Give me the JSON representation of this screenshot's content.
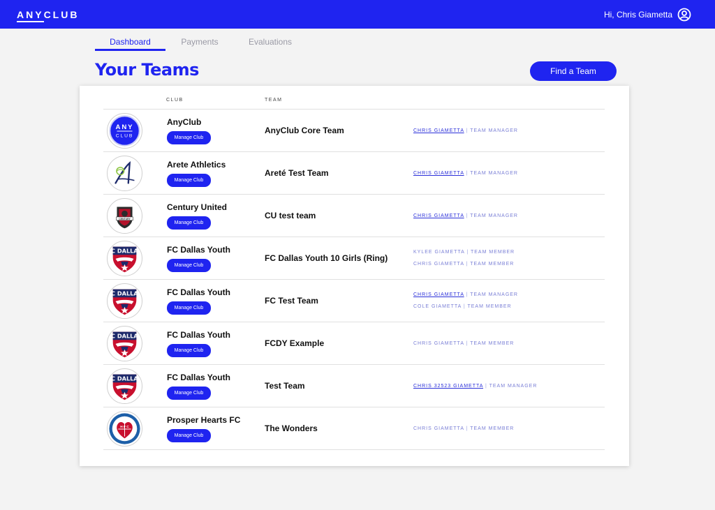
{
  "header": {
    "brand_pre": "ANY",
    "brand_post": "CLUB",
    "greeting": "Hi, Chris Giametta",
    "user_icon": "user-circle-icon"
  },
  "tabs": [
    {
      "label": "Dashboard",
      "active": true
    },
    {
      "label": "Payments",
      "active": false
    },
    {
      "label": "Evaluations",
      "active": false
    }
  ],
  "page_title": "Your Teams",
  "find_team_label": "Find a Team",
  "table": {
    "headers": {
      "club": "CLUB",
      "team": "TEAM"
    },
    "manage_label": "Manage Club",
    "rows": [
      {
        "club": "AnyClub",
        "team": "AnyClub Core Team",
        "logo": "anyclub",
        "members": [
          {
            "name": "CHRIS GIAMETTA",
            "role": "TEAM MANAGER",
            "link": true
          }
        ]
      },
      {
        "club": "Arete Athletics",
        "team": "Areté Test Team",
        "logo": "arete",
        "members": [
          {
            "name": "CHRIS GIAMETTA",
            "role": "TEAM MANAGER",
            "link": true
          }
        ]
      },
      {
        "club": "Century United",
        "team": "CU test team",
        "logo": "century",
        "members": [
          {
            "name": "CHRIS GIAMETTA",
            "role": "TEAM MANAGER",
            "link": true
          }
        ]
      },
      {
        "club": "FC Dallas Youth",
        "team": "FC Dallas Youth 10 Girls (Ring)",
        "logo": "fcdallas",
        "members": [
          {
            "name": "KYLEE GIAMETTA",
            "role": "TEAM MEMBER",
            "link": false
          },
          {
            "name": "CHRIS GIAMETTA",
            "role": "TEAM MEMBER",
            "link": false
          }
        ]
      },
      {
        "club": "FC Dallas Youth",
        "team": "FC Test Team",
        "logo": "fcdallas",
        "members": [
          {
            "name": "CHRIS GIAMETTA",
            "role": "TEAM MANAGER",
            "link": true
          },
          {
            "name": "COLE GIAMETTA",
            "role": "TEAM MEMBER",
            "link": false
          }
        ]
      },
      {
        "club": "FC Dallas Youth",
        "team": "FCDY Example",
        "logo": "fcdallas",
        "members": [
          {
            "name": "CHRIS GIAMETTA",
            "role": "TEAM MEMBER",
            "link": false
          }
        ]
      },
      {
        "club": "FC Dallas Youth",
        "team": "Test Team",
        "logo": "fcdallas",
        "members": [
          {
            "name": "CHRIS 32523 GIAMETTA",
            "role": "TEAM MANAGER",
            "link": true
          }
        ]
      },
      {
        "club": "Prosper Hearts FC",
        "team": "The Wonders",
        "logo": "prosper",
        "members": [
          {
            "name": "CHRIS GIAMETTA",
            "role": "TEAM MEMBER",
            "link": false
          }
        ]
      }
    ]
  },
  "logo_text": {
    "anyclub_top": "ANY",
    "anyclub_bottom": "CLUB",
    "fcdallas": "FC DALLAS",
    "century": "CENTURY",
    "prosper": "H F C"
  },
  "colors": {
    "brand_blue": "#1f24f0",
    "member_text": "#7a7fd6",
    "fc_dallas_red": "#c8102e",
    "fc_dallas_navy": "#1d2a6b"
  }
}
